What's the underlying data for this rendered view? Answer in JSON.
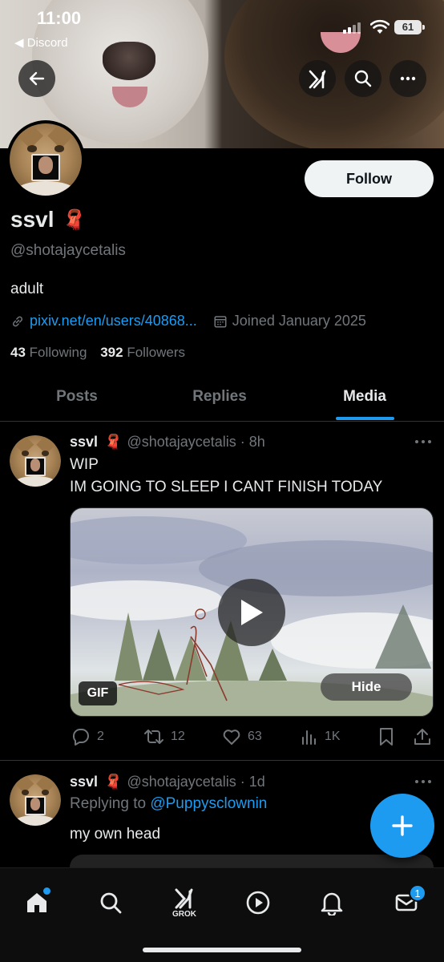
{
  "status_bar": {
    "time": "11:00",
    "back_app": "◀ Discord",
    "battery": "61"
  },
  "profile": {
    "display_name": "ssvl",
    "name_emoji": "🧣",
    "handle": "@shotajaycetalis",
    "bio": "adult",
    "link": "pixiv.net/en/users/40868...",
    "joined": "Joined January 2025",
    "following_count": "43",
    "following_label": "Following",
    "followers_count": "392",
    "followers_label": "Followers",
    "follow_button": "Follow"
  },
  "tabs": [
    {
      "label": "Posts"
    },
    {
      "label": "Replies"
    },
    {
      "label": "Media"
    }
  ],
  "active_tab": "Media",
  "tweets": [
    {
      "name": "ssvl",
      "emoji": "🧣",
      "handle_time": "@shotajaycetalis · 8h",
      "text_line1": "WIP",
      "text_line2": "IM GOING TO SLEEP I CANT FINISH TODAY",
      "media_badge": "GIF",
      "hide_label": "Hide",
      "replies": "2",
      "reposts": "12",
      "likes": "63",
      "views": "1K"
    },
    {
      "name": "ssvl",
      "emoji": "🧣",
      "handle_time": "@shotajaycetalis · 1d",
      "replying_prefix": "Replying to",
      "replying_to": "@Puppysclownin",
      "text": "my own head"
    }
  ],
  "bottom_nav": {
    "grok_label": "GROK",
    "messages_badge": "1"
  },
  "colors": {
    "accent": "#1d9bf0",
    "background": "#000000",
    "muted_text": "#71767b",
    "primary_text": "#e7e9ea"
  },
  "icons": [
    "back-arrow-icon",
    "grok-icon",
    "search-icon",
    "more-icon",
    "link-icon",
    "calendar-icon",
    "play-icon",
    "reply-icon",
    "repost-icon",
    "like-icon",
    "views-icon",
    "bookmark-icon",
    "share-icon",
    "compose-icon",
    "home-icon",
    "notifications-icon",
    "messages-icon"
  ]
}
